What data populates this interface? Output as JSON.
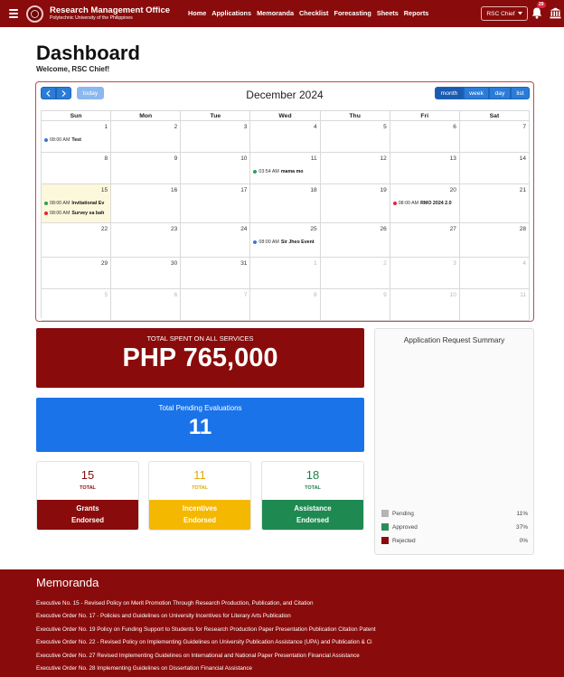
{
  "app": {
    "title": "Research Management Office",
    "subtitle": "Polytechnic University of the Philippines"
  },
  "nav": [
    "Home",
    "Applications",
    "Memoranda",
    "Checklist",
    "Forecasting",
    "Sheets",
    "Reports"
  ],
  "user": {
    "role": "RSC Chief",
    "notifications": "29"
  },
  "page": {
    "title": "Dashboard",
    "welcome": "Welcome, RSC Chief!"
  },
  "calendar": {
    "title": "December 2024",
    "today_label": "today",
    "views": [
      "month",
      "week",
      "day",
      "list"
    ],
    "weekdays": [
      "Sun",
      "Mon",
      "Tue",
      "Wed",
      "Thu",
      "Fri",
      "Sat"
    ],
    "weeks": [
      [
        {
          "d": "1"
        },
        {
          "d": "2"
        },
        {
          "d": "3"
        },
        {
          "d": "4"
        },
        {
          "d": "5"
        },
        {
          "d": "6"
        },
        {
          "d": "7"
        }
      ],
      [
        {
          "d": "8"
        },
        {
          "d": "9"
        },
        {
          "d": "10"
        },
        {
          "d": "11"
        },
        {
          "d": "12"
        },
        {
          "d": "13"
        },
        {
          "d": "14"
        }
      ],
      [
        {
          "d": "15",
          "today": true
        },
        {
          "d": "16"
        },
        {
          "d": "17"
        },
        {
          "d": "18"
        },
        {
          "d": "19"
        },
        {
          "d": "20"
        },
        {
          "d": "21"
        }
      ],
      [
        {
          "d": "22"
        },
        {
          "d": "23"
        },
        {
          "d": "24"
        },
        {
          "d": "25"
        },
        {
          "d": "26"
        },
        {
          "d": "27"
        },
        {
          "d": "28"
        }
      ],
      [
        {
          "d": "29"
        },
        {
          "d": "30"
        },
        {
          "d": "31"
        },
        {
          "d": "1",
          "other": true
        },
        {
          "d": "2",
          "other": true
        },
        {
          "d": "3",
          "other": true
        },
        {
          "d": "4",
          "other": true
        }
      ],
      [
        {
          "d": "5",
          "other": true
        },
        {
          "d": "6",
          "other": true
        },
        {
          "d": "7",
          "other": true
        },
        {
          "d": "8",
          "other": true
        },
        {
          "d": "9",
          "other": true
        },
        {
          "d": "10",
          "other": true
        },
        {
          "d": "11",
          "other": true
        }
      ]
    ],
    "events": [
      {
        "week": 0,
        "day": 0,
        "slot": 0,
        "time": "08:00 AM",
        "title": "Test",
        "color": "#3b78d8"
      },
      {
        "week": 1,
        "day": 3,
        "slot": 0,
        "time": "03:54 AM",
        "title": "mama mo",
        "color": "#2e9d5a"
      },
      {
        "week": 2,
        "day": 0,
        "slot": 0,
        "time": "08:00 AM",
        "title": "Invitational Ev",
        "color": "#2e9d5a"
      },
      {
        "week": 2,
        "day": 0,
        "slot": 1,
        "time": "08:00 AM",
        "title": "Survey sa bah",
        "color": "#e0243c"
      },
      {
        "week": 2,
        "day": 5,
        "slot": 0,
        "time": "08:00 AM",
        "title": "RMO 2024 2.0",
        "color": "#e0243c"
      },
      {
        "week": 3,
        "day": 3,
        "slot": 0,
        "time": "08:00 AM",
        "title": "Sir Jheo Event",
        "color": "#3b78d8"
      }
    ]
  },
  "stats": {
    "spent": {
      "label": "TOTAL SPENT ON ALL SERVICES",
      "value": "PHP 765,000"
    },
    "pending": {
      "label": "Total Pending Evaluations",
      "value": "11"
    },
    "cards": [
      {
        "value": "15",
        "total_label": "TOTAL",
        "line1": "Grants",
        "line2": "Endorsed",
        "num_color": "#8a0b0b",
        "foot_color": "#8a0b0b"
      },
      {
        "value": "11",
        "total_label": "TOTAL",
        "line1": "Incentives",
        "line2": "Endorsed",
        "num_color": "#e0a800",
        "foot_color": "#f5b800"
      },
      {
        "value": "18",
        "total_label": "TOTAL",
        "line1": "Assistance",
        "line2": "Endorsed",
        "num_color": "#1e7e4a",
        "foot_color": "#1e8a52"
      }
    ]
  },
  "summary": {
    "title": "Application Request Summary",
    "legend": [
      {
        "label": "Pending",
        "pct": "11%",
        "color": "#b5b5b5"
      },
      {
        "label": "Approved",
        "pct": "37%",
        "color": "#2e8b57"
      },
      {
        "label": "Rejected",
        "pct": "0%",
        "color": "#8a0b0b"
      }
    ]
  },
  "memoranda": {
    "title": "Memoranda",
    "items": [
      "Executive No. 15 - Revised Policy on Merit Promotion Through Research Production, Publication, and Citation",
      "Executive Order No. 17 - Policies and Guidelines on University Incentives for Literary Arts Publication",
      "Executive Order No. 19 Policy on Funding Support to Students for Research Production Paper Presentation Publication Citation Patent",
      "Executive Order No. 22 - Revised Policy on Implementing Guidelines on University Publication Assistance (UPA) and Publication & Ci",
      "Executive Order No. 27 Revised Implementing Guidelines on International and National Paper Presentation Financial Assistance",
      "Executive Order No. 28 Implementing Guidelines on Dissertation Financial Assistance"
    ]
  }
}
